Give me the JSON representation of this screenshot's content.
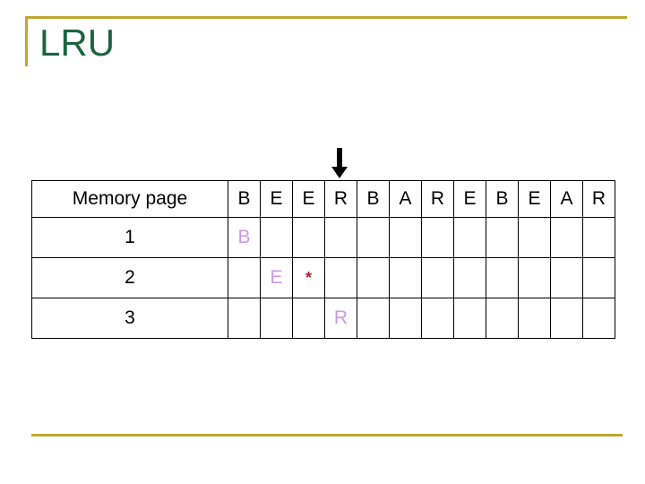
{
  "slide": {
    "title": "LRU",
    "accent_color": "#BFA930",
    "title_color": "#1C6442",
    "page_value_color": "#CC99DD",
    "marker_color": "#B01C2E",
    "background_color": "#FFFFFF"
  },
  "arrow": {
    "icon": "arrow-down-icon",
    "points_to_column_index": 4,
    "color": "#000000"
  },
  "table": {
    "label_header": "Memory page",
    "reference_string": [
      "B",
      "E",
      "E",
      "R",
      "B",
      "A",
      "R",
      "E",
      "B",
      "E",
      "A",
      "R"
    ],
    "rows": [
      {
        "label": "1",
        "cells": [
          "B",
          "",
          "",
          "",
          "",
          "",
          "",
          "",
          "",
          "",
          "",
          ""
        ]
      },
      {
        "label": "2",
        "cells": [
          "",
          "E",
          "*",
          "",
          "",
          "",
          "",
          "",
          "",
          "",
          "",
          ""
        ]
      },
      {
        "label": "3",
        "cells": [
          "",
          "",
          "",
          "R",
          "",
          "",
          "",
          "",
          "",
          "",
          "",
          ""
        ]
      }
    ]
  }
}
